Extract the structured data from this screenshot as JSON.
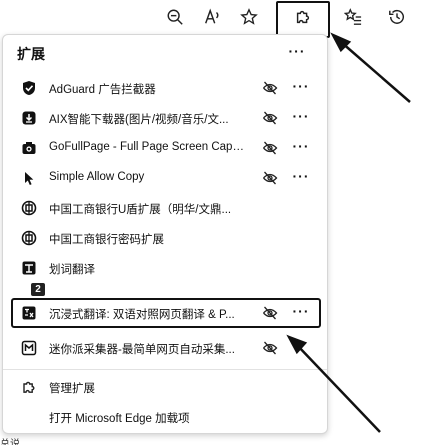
{
  "toolbar": {
    "buttons": [
      "zoom-out-icon",
      "read-aloud-icon",
      "favorite-star-icon",
      "extensions-icon",
      "favorites-list-icon",
      "history-icon"
    ]
  },
  "panel": {
    "title": "扩展",
    "more_label": "···"
  },
  "extensions": [
    {
      "name": "AdGuard 广告拦截器",
      "icon": "adguard-shield-icon",
      "more": "···"
    },
    {
      "name": "AIX智能下载器(图片/视频/音乐/文...",
      "icon": "aix-downloader-icon",
      "more": "···"
    },
    {
      "name": "GoFullPage - Full Page Screen Capt...",
      "icon": "camera-icon",
      "more": "···"
    },
    {
      "name": "Simple Allow Copy",
      "icon": "cursor-icon",
      "more": "···"
    },
    {
      "name": "中国工商银行U盾扩展（明华/文鼎...",
      "icon": "icbc-logo-icon",
      "more": "···"
    },
    {
      "name": "中国工商银行密码扩展",
      "icon": "icbc-logo-icon",
      "more": "···"
    },
    {
      "name": "划词翻译",
      "icon": "translate-icon",
      "more": ""
    },
    {
      "name": "沉浸式翻译: 双语对照网页翻译 & P...",
      "icon": "immersive-translate-icon",
      "more": "···"
    },
    {
      "name": "迷你派采集器-最简单网页自动采集...",
      "icon": "collector-icon",
      "more": "···"
    }
  ],
  "badge": "2",
  "footer": {
    "manage": "管理扩展",
    "open_addons": "打开 Microsoft Edge 加载项"
  },
  "bottom_text": "总说"
}
